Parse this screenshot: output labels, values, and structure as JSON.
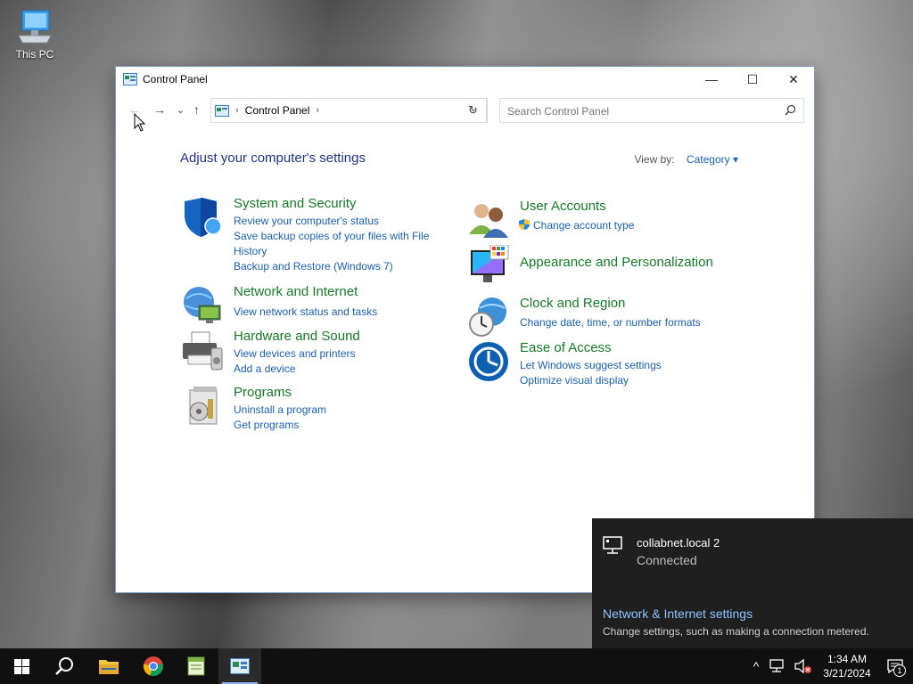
{
  "desktop": {
    "this_pc_label": "This PC"
  },
  "window": {
    "title": "Control Panel",
    "minimize": "—",
    "maximize": "☐",
    "close": "✕"
  },
  "nav": {
    "back": "←",
    "forward": "→",
    "recent": "⌄",
    "up": "↑",
    "breadcrumb": [
      "Control Panel"
    ],
    "refresh": "↻",
    "search_placeholder": "Search Control Panel"
  },
  "main": {
    "heading": "Adjust your computer's settings",
    "view_by_label": "View by:",
    "view_by_value": "Category ▾"
  },
  "categories_left": [
    {
      "icon": "shield-icon",
      "title": "System and Security",
      "links": [
        "Review your computer's status",
        "Save backup copies of your files with File History",
        "Backup and Restore (Windows 7)"
      ]
    },
    {
      "icon": "network-icon",
      "title": "Network and Internet",
      "links": [
        "View network status and tasks"
      ]
    },
    {
      "icon": "printer-icon",
      "title": "Hardware and Sound",
      "links": [
        "View devices and printers",
        "Add a device"
      ]
    },
    {
      "icon": "programs-icon",
      "title": "Programs",
      "links": [
        "Uninstall a program",
        "Get programs"
      ]
    }
  ],
  "categories_right": [
    {
      "icon": "users-icon",
      "title": "User Accounts",
      "links": [
        "Change account type"
      ]
    },
    {
      "icon": "monitor-icon",
      "title": "Appearance and Personalization",
      "links": []
    },
    {
      "icon": "clock-globe-icon",
      "title": "Clock and Region",
      "links": [
        "Change date, time, or number formats"
      ]
    },
    {
      "icon": "ease-of-access-icon",
      "title": "Ease of Access",
      "links": [
        "Let Windows suggest settings",
        "Optimize visual display"
      ]
    }
  ],
  "flyout": {
    "network_name": "collabnet.local 2",
    "network_status": "Connected",
    "settings_link": "Network & Internet settings",
    "settings_desc": "Change settings, such as making a connection metered."
  },
  "taskbar": {
    "time": "1:34 AM",
    "date": "3/21/2024",
    "notification_count": "1",
    "chevron": "^"
  },
  "colors": {
    "link": "#1a5fb4",
    "category_title": "#157a27",
    "heading": "#1e3287",
    "taskbar": "#101010",
    "flyout": "#1f1f1f"
  }
}
